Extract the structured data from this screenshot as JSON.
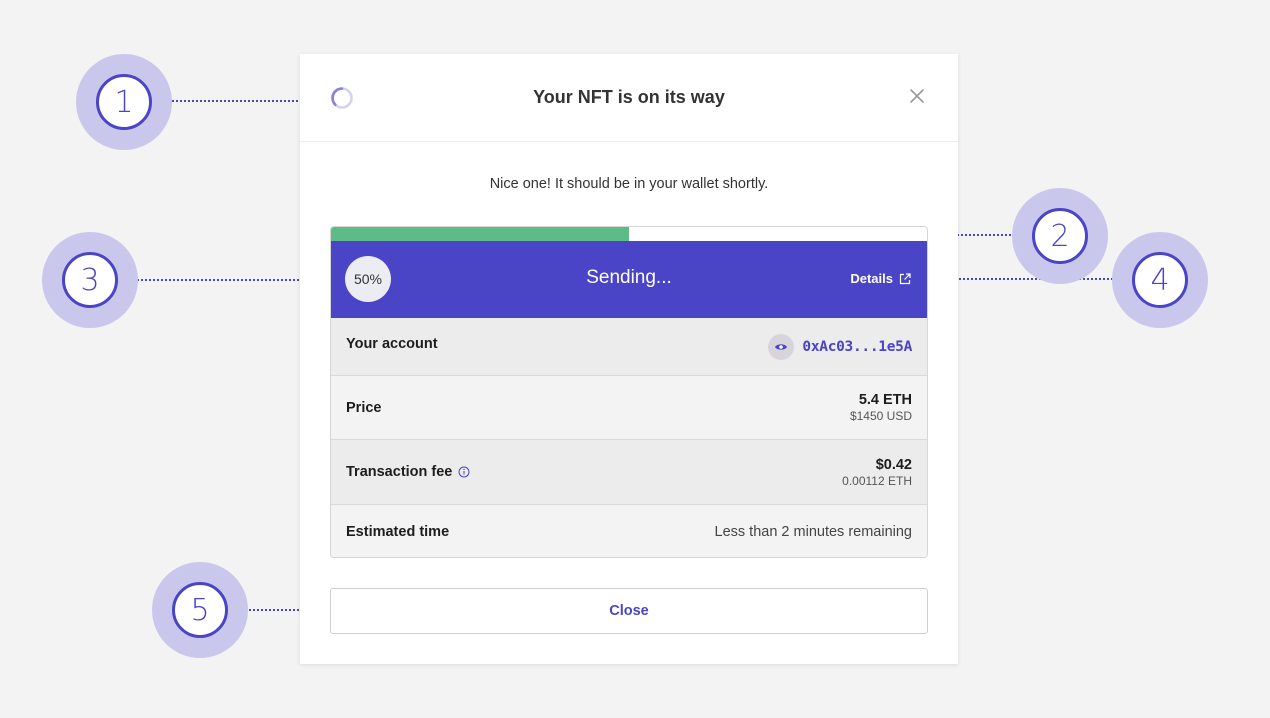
{
  "annotations": [
    "1",
    "2",
    "3",
    "4",
    "5"
  ],
  "modal": {
    "title": "Your NFT is on its way",
    "subtitle": "Nice one! It should be in your wallet shortly.",
    "progress_fraction": 0.5
  },
  "status": {
    "percent_label": "50%",
    "text": "Sending...",
    "details_label": "Details"
  },
  "rows": {
    "account": {
      "label": "Your account",
      "value": "0xAc03...1e5A"
    },
    "price": {
      "label": "Price",
      "value_main": "5.4 ETH",
      "value_sub": "$1450 USD"
    },
    "fee": {
      "label": "Transaction fee",
      "value_main": "$0.42",
      "value_sub": "0.00112 ETH"
    },
    "time": {
      "label": "Estimated time",
      "value": "Less than 2 minutes remaining"
    }
  },
  "close_button": "Close",
  "colors": {
    "accent": "#4a44c6",
    "progress": "#5dbb85",
    "callout_halo": "#cac7ed"
  },
  "icons": [
    "spinner-icon",
    "close-icon",
    "external-link-icon",
    "eye-icon",
    "info-icon"
  ]
}
